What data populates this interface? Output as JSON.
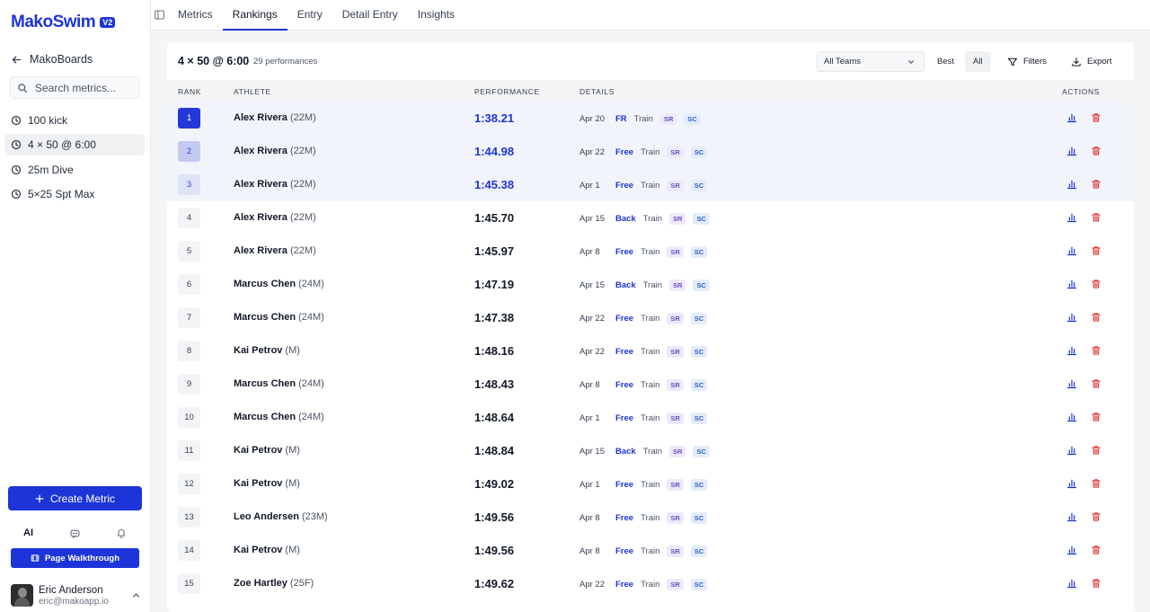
{
  "app": {
    "logo": "MakoSwim",
    "version_badge": "V2",
    "back_label": "MakoBoards",
    "search_placeholder": "Search metrics..."
  },
  "sidebar": {
    "metrics": [
      {
        "label": "100 kick",
        "active": false
      },
      {
        "label": "4 × 50 @ 6:00",
        "active": true
      },
      {
        "label": "25m Dive",
        "active": false
      },
      {
        "label": "5×25 Spt Max",
        "active": false
      }
    ],
    "create_label": "Create Metric",
    "bottom_tabs": {
      "ai": "AI"
    },
    "walkthrough_label": "Page Walkthrough",
    "user": {
      "name": "Eric Anderson",
      "email": "eric@makoapp.io"
    }
  },
  "topnav": {
    "tabs": [
      {
        "label": "Metrics",
        "active": false
      },
      {
        "label": "Rankings",
        "active": true
      },
      {
        "label": "Entry",
        "active": false
      },
      {
        "label": "Detail Entry",
        "active": false
      },
      {
        "label": "Insights",
        "active": false
      }
    ]
  },
  "card": {
    "title": "4 × 50 @ 6:00",
    "count": "29 performances",
    "team_select": "All Teams",
    "toggle": [
      {
        "label": "Best",
        "active": false
      },
      {
        "label": "All",
        "active": true
      }
    ],
    "filters_label": "Filters",
    "export_label": "Export"
  },
  "table": {
    "headers": {
      "rank": "RANK",
      "athlete": "ATHLETE",
      "performance": "PERFORMANCE",
      "details": "DETAILS",
      "actions": "ACTIONS"
    },
    "rows": [
      {
        "rank": "1",
        "name": "Alex Rivera",
        "meta": "(22M)",
        "time": "1:38.21",
        "date": "Apr 20",
        "stroke": "FR",
        "type": "Train",
        "tag1": "SR",
        "tag2": "SC"
      },
      {
        "rank": "2",
        "name": "Alex Rivera",
        "meta": "(22M)",
        "time": "1:44.98",
        "date": "Apr 22",
        "stroke": "Free",
        "type": "Train",
        "tag1": "SR",
        "tag2": "SC"
      },
      {
        "rank": "3",
        "name": "Alex Rivera",
        "meta": "(22M)",
        "time": "1:45.38",
        "date": "Apr 1",
        "stroke": "Free",
        "type": "Train",
        "tag1": "SR",
        "tag2": "SC"
      },
      {
        "rank": "4",
        "name": "Alex Rivera",
        "meta": "(22M)",
        "time": "1:45.70",
        "date": "Apr 15",
        "stroke": "Back",
        "type": "Train",
        "tag1": "SR",
        "tag2": "SC"
      },
      {
        "rank": "5",
        "name": "Alex Rivera",
        "meta": "(22M)",
        "time": "1:45.97",
        "date": "Apr 8",
        "stroke": "Free",
        "type": "Train",
        "tag1": "SR",
        "tag2": "SC"
      },
      {
        "rank": "6",
        "name": "Marcus Chen",
        "meta": "(24M)",
        "time": "1:47.19",
        "date": "Apr 15",
        "stroke": "Back",
        "type": "Train",
        "tag1": "SR",
        "tag2": "SC"
      },
      {
        "rank": "7",
        "name": "Marcus Chen",
        "meta": "(24M)",
        "time": "1:47.38",
        "date": "Apr 22",
        "stroke": "Free",
        "type": "Train",
        "tag1": "SR",
        "tag2": "SC"
      },
      {
        "rank": "8",
        "name": "Kai Petrov",
        "meta": "(M)",
        "time": "1:48.16",
        "date": "Apr 22",
        "stroke": "Free",
        "type": "Train",
        "tag1": "SR",
        "tag2": "SC"
      },
      {
        "rank": "9",
        "name": "Marcus Chen",
        "meta": "(24M)",
        "time": "1:48.43",
        "date": "Apr 8",
        "stroke": "Free",
        "type": "Train",
        "tag1": "SR",
        "tag2": "SC"
      },
      {
        "rank": "10",
        "name": "Marcus Chen",
        "meta": "(24M)",
        "time": "1:48.64",
        "date": "Apr 1",
        "stroke": "Free",
        "type": "Train",
        "tag1": "SR",
        "tag2": "SC"
      },
      {
        "rank": "11",
        "name": "Kai Petrov",
        "meta": "(M)",
        "time": "1:48.84",
        "date": "Apr 15",
        "stroke": "Back",
        "type": "Train",
        "tag1": "SR",
        "tag2": "SC"
      },
      {
        "rank": "12",
        "name": "Kai Petrov",
        "meta": "(M)",
        "time": "1:49.02",
        "date": "Apr 1",
        "stroke": "Free",
        "type": "Train",
        "tag1": "SR",
        "tag2": "SC"
      },
      {
        "rank": "13",
        "name": "Leo Andersen",
        "meta": "(23M)",
        "time": "1:49.56",
        "date": "Apr 8",
        "stroke": "Free",
        "type": "Train",
        "tag1": "SR",
        "tag2": "SC"
      },
      {
        "rank": "14",
        "name": "Kai Petrov",
        "meta": "(M)",
        "time": "1:49.56",
        "date": "Apr 8",
        "stroke": "Free",
        "type": "Train",
        "tag1": "SR",
        "tag2": "SC"
      },
      {
        "rank": "15",
        "name": "Zoe Hartley",
        "meta": "(25F)",
        "time": "1:49.62",
        "date": "Apr 22",
        "stroke": "Free",
        "type": "Train",
        "tag1": "SR",
        "tag2": "SC"
      }
    ]
  },
  "colors": {
    "accent": "#1d35d8",
    "danger": "#dc2626",
    "tag_sr": "#6d4fc2",
    "tag_sc": "#2f62c9"
  }
}
